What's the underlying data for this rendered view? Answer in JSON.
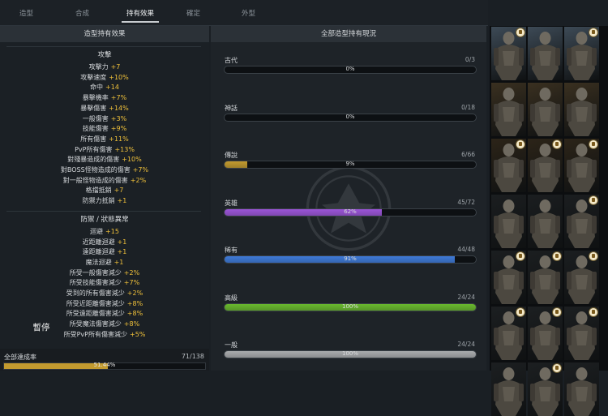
{
  "tabs": [
    "造型",
    "合成",
    "持有效果",
    "確定",
    "外型"
  ],
  "left_panel": {
    "title": "造型持有效果",
    "sections": [
      {
        "title": "攻擊",
        "stats": [
          {
            "name": "攻擊力",
            "value": "+7"
          },
          {
            "name": "攻擊速度",
            "value": "+10%"
          },
          {
            "name": "命中",
            "value": "+14"
          },
          {
            "name": "暴擊機率",
            "value": "+7%"
          },
          {
            "name": "暴擊傷害",
            "value": "+14%"
          },
          {
            "name": "一般傷害",
            "value": "+3%"
          },
          {
            "name": "技能傷害",
            "value": "+9%"
          },
          {
            "name": "所有傷害",
            "value": "+11%"
          },
          {
            "name": "PvP所有傷害",
            "value": "+13%"
          },
          {
            "name": "對殘暴造成的傷害",
            "value": "+10%"
          },
          {
            "name": "對BOSS怪物造成的傷害",
            "value": "+7%"
          },
          {
            "name": "對一般怪物造成的傷害",
            "value": "+2%"
          },
          {
            "name": "格擋抵銷",
            "value": "+7"
          },
          {
            "name": "防禦力抵銷",
            "value": "+1"
          }
        ]
      },
      {
        "title": "防禦 / 狀態異常",
        "stats": [
          {
            "name": "迴避",
            "value": "+15"
          },
          {
            "name": "近距離迴避",
            "value": "+1"
          },
          {
            "name": "遠距離迴避",
            "value": "+1"
          },
          {
            "name": "魔法迴避",
            "value": "+1"
          },
          {
            "name": "所受一般傷害減少",
            "value": "+2%"
          },
          {
            "name": "所受技能傷害減少",
            "value": "+7%"
          },
          {
            "name": "受到的所有傷害減少",
            "value": "+2%"
          },
          {
            "name": "所受近距離傷害減少",
            "value": "+8%"
          },
          {
            "name": "所受遠距離傷害減少",
            "value": "+8%"
          },
          {
            "name": "所受魔法傷害減少",
            "value": "+8%"
          },
          {
            "name": "所受PvP所有傷害減少",
            "value": "+5%"
          }
        ]
      }
    ],
    "pause_label": "暫停",
    "achievement": {
      "label": "全部達成率",
      "count": "71/138",
      "percent_text": "51.44%",
      "fraction": 0.5144
    }
  },
  "middle_panel": {
    "title": "全部造型持有現況",
    "rarities": [
      {
        "name": "古代",
        "count": "0/3",
        "percent": "0%",
        "fraction": 0,
        "color": "#c29a2f"
      },
      {
        "name": "神話",
        "count": "0/18",
        "percent": "0%",
        "fraction": 0,
        "color": "#c29a2f"
      },
      {
        "name": "傳說",
        "count": "6/66",
        "percent": "9%",
        "fraction": 0.09,
        "color": "#c29a2f"
      },
      {
        "name": "英雄",
        "count": "45/72",
        "percent": "62%",
        "fraction": 0.625,
        "color": "#9b55d8"
      },
      {
        "name": "稀有",
        "count": "44/48",
        "percent": "91%",
        "fraction": 0.917,
        "color": "#3f7ad8"
      },
      {
        "name": "高級",
        "count": "24/24",
        "percent": "100%",
        "fraction": 1,
        "color": "#69b82e"
      },
      {
        "name": "一般",
        "count": "24/24",
        "percent": "100%",
        "fraction": 1,
        "color": "#a9acae"
      }
    ]
  },
  "grid": {
    "rows": [
      {
        "bg": "#3d4a56",
        "badges": [
          true,
          false,
          true
        ]
      },
      {
        "bg": "#3a3020",
        "badges": [
          false,
          false,
          false
        ]
      },
      {
        "bg": "#2c2418",
        "badges": [
          true,
          true,
          true
        ]
      },
      {
        "bg": "#1b1e20",
        "badges": [
          false,
          false,
          true
        ]
      },
      {
        "bg": "#1b1e20",
        "badges": [
          true,
          true,
          true
        ]
      },
      {
        "bg": "#1c1f21",
        "badges": [
          true,
          true,
          true
        ]
      },
      {
        "bg": "#1c1f21",
        "badges": [
          false,
          true,
          false
        ]
      }
    ]
  }
}
